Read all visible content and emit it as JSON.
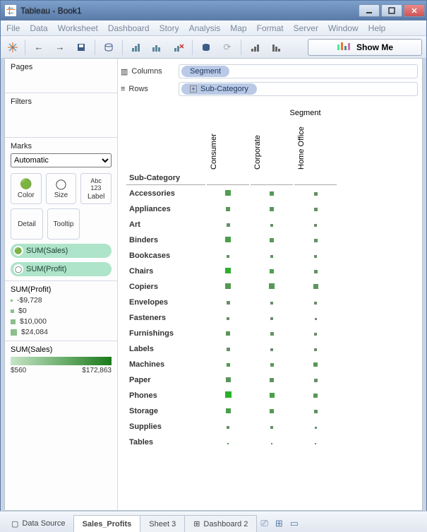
{
  "window": {
    "title": "Tableau - Book1"
  },
  "menu": {
    "items": [
      "File",
      "Data",
      "Worksheet",
      "Dashboard",
      "Story",
      "Analysis",
      "Map",
      "Format",
      "Server",
      "Window",
      "Help"
    ]
  },
  "showme": {
    "label": "Show Me"
  },
  "shelves": {
    "columns_label": "Columns",
    "rows_label": "Rows",
    "columns_pill": "Segment",
    "rows_pill": "Sub-Category"
  },
  "panels": {
    "pages": "Pages",
    "filters": "Filters",
    "marks": "Marks",
    "marks_mode": "Automatic",
    "color": "Color",
    "size": "Size",
    "label": "Label",
    "detail": "Detail",
    "tooltip": "Tooltip",
    "pill_sales": "SUM(Sales)",
    "pill_profit": "SUM(Profit)"
  },
  "legend_profit": {
    "title": "SUM(Profit)",
    "items": [
      {
        "label": "-$9,728",
        "size": 3
      },
      {
        "label": "$0",
        "size": 5
      },
      {
        "label": "$10,000",
        "size": 7
      },
      {
        "label": "$24,084",
        "size": 9
      }
    ]
  },
  "legend_sales": {
    "title": "SUM(Sales)",
    "min": "$560",
    "max": "$172,863"
  },
  "tabs": {
    "datasource": "Data Source",
    "items": [
      "Sales_Profits",
      "Sheet 3",
      "Dashboard 2"
    ],
    "active": 0
  },
  "chart_data": {
    "type": "heatmap",
    "title": "Segment",
    "row_field": "Sub-Category",
    "col_field": "Segment",
    "columns": [
      "Consumer",
      "Corporate",
      "Home Office"
    ],
    "size_encodes": "SUM(Profit)",
    "color_encodes": "SUM(Sales)",
    "size_range": [
      -9728,
      24084
    ],
    "color_range": [
      560,
      172863
    ],
    "rows": [
      {
        "cat": "Accessories",
        "cells": [
          {
            "sz": 8,
            "cl": 0.55
          },
          {
            "sz": 6,
            "cl": 0.44
          },
          {
            "sz": 5,
            "cl": 0.3
          }
        ]
      },
      {
        "cat": "Appliances",
        "cells": [
          {
            "sz": 6,
            "cl": 0.4
          },
          {
            "sz": 6,
            "cl": 0.4
          },
          {
            "sz": 5,
            "cl": 0.3
          }
        ]
      },
      {
        "cat": "Art",
        "cells": [
          {
            "sz": 5,
            "cl": 0.3
          },
          {
            "sz": 4,
            "cl": 0.25
          },
          {
            "sz": 4,
            "cl": 0.22
          }
        ]
      },
      {
        "cat": "Binders",
        "cells": [
          {
            "sz": 8,
            "cl": 0.6
          },
          {
            "sz": 6,
            "cl": 0.45
          },
          {
            "sz": 5,
            "cl": 0.32
          }
        ]
      },
      {
        "cat": "Bookcases",
        "cells": [
          {
            "sz": 4,
            "cl": 0.35
          },
          {
            "sz": 4,
            "cl": 0.3
          },
          {
            "sz": 4,
            "cl": 0.22
          }
        ]
      },
      {
        "cat": "Chairs",
        "cells": [
          {
            "sz": 8,
            "cl": 0.9
          },
          {
            "sz": 6,
            "cl": 0.55
          },
          {
            "sz": 5,
            "cl": 0.35
          }
        ]
      },
      {
        "cat": "Copiers",
        "cells": [
          {
            "sz": 8,
            "cl": 0.5
          },
          {
            "sz": 8,
            "cl": 0.45
          },
          {
            "sz": 7,
            "cl": 0.38
          }
        ]
      },
      {
        "cat": "Envelopes",
        "cells": [
          {
            "sz": 5,
            "cl": 0.25
          },
          {
            "sz": 4,
            "cl": 0.22
          },
          {
            "sz": 4,
            "cl": 0.2
          }
        ]
      },
      {
        "cat": "Fasteners",
        "cells": [
          {
            "sz": 4,
            "cl": 0.18
          },
          {
            "sz": 4,
            "cl": 0.16
          },
          {
            "sz": 3,
            "cl": 0.14
          }
        ]
      },
      {
        "cat": "Furnishings",
        "cells": [
          {
            "sz": 6,
            "cl": 0.4
          },
          {
            "sz": 5,
            "cl": 0.32
          },
          {
            "sz": 4,
            "cl": 0.24
          }
        ]
      },
      {
        "cat": "Labels",
        "cells": [
          {
            "sz": 5,
            "cl": 0.22
          },
          {
            "sz": 4,
            "cl": 0.2
          },
          {
            "sz": 4,
            "cl": 0.18
          }
        ]
      },
      {
        "cat": "Machines",
        "cells": [
          {
            "sz": 5,
            "cl": 0.55
          },
          {
            "sz": 5,
            "cl": 0.42
          },
          {
            "sz": 6,
            "cl": 0.4
          }
        ]
      },
      {
        "cat": "Paper",
        "cells": [
          {
            "sz": 7,
            "cl": 0.4
          },
          {
            "sz": 6,
            "cl": 0.32
          },
          {
            "sz": 5,
            "cl": 0.25
          }
        ]
      },
      {
        "cat": "Phones",
        "cells": [
          {
            "sz": 9,
            "cl": 0.95
          },
          {
            "sz": 7,
            "cl": 0.6
          },
          {
            "sz": 6,
            "cl": 0.42
          }
        ]
      },
      {
        "cat": "Storage",
        "cells": [
          {
            "sz": 7,
            "cl": 0.6
          },
          {
            "sz": 6,
            "cl": 0.45
          },
          {
            "sz": 5,
            "cl": 0.32
          }
        ]
      },
      {
        "cat": "Supplies",
        "cells": [
          {
            "sz": 4,
            "cl": 0.28
          },
          {
            "sz": 4,
            "cl": 0.24
          },
          {
            "sz": 3,
            "cl": 0.2
          }
        ]
      },
      {
        "cat": "Tables",
        "cells": [
          {
            "sz": 2,
            "cl": 0.55
          },
          {
            "sz": 2,
            "cl": 0.4
          },
          {
            "sz": 2,
            "cl": 0.3
          }
        ]
      }
    ]
  }
}
